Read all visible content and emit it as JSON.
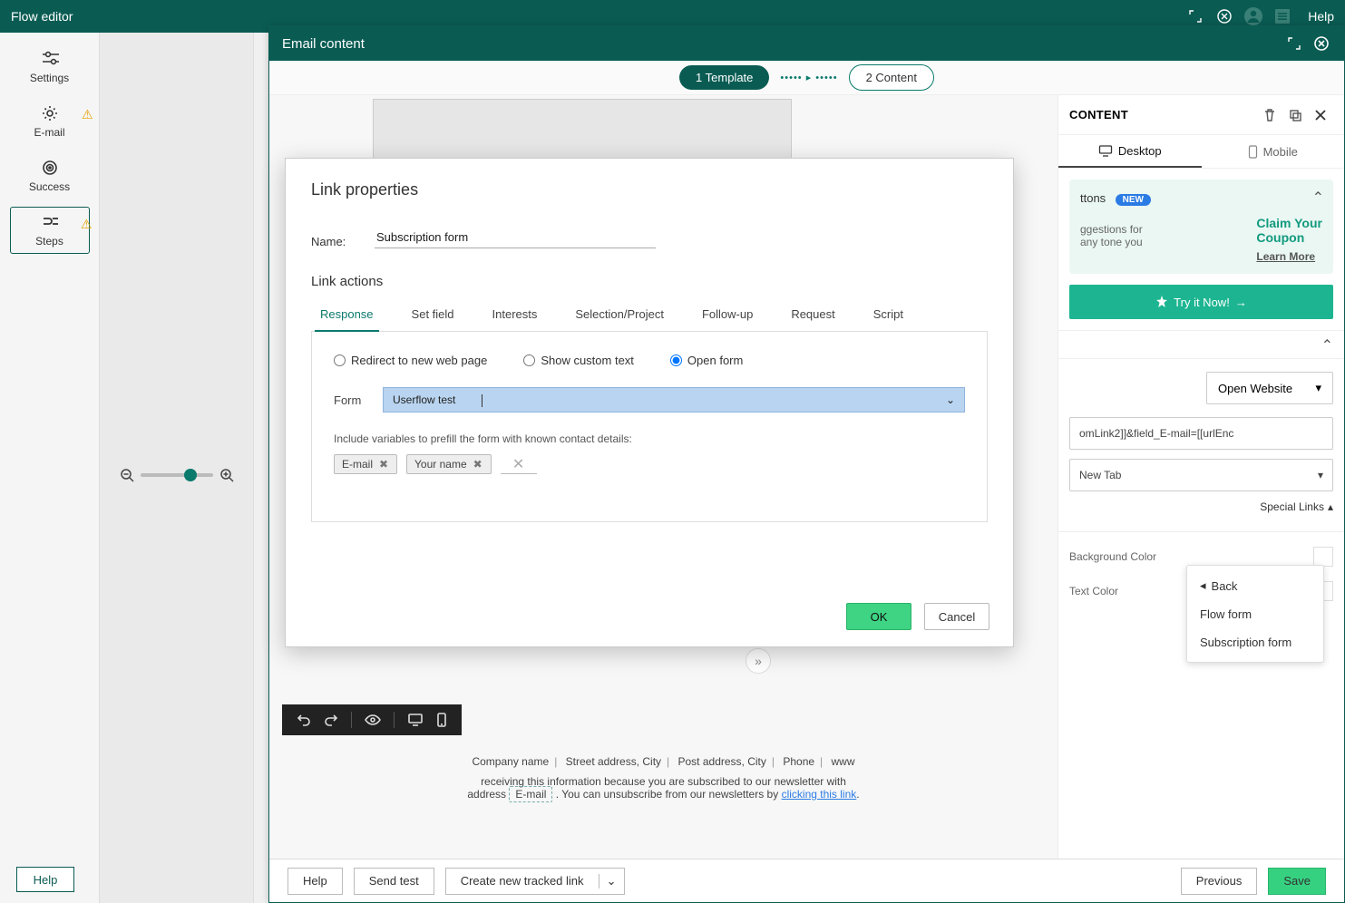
{
  "topbar": {
    "title": "Flow editor",
    "help": "Help"
  },
  "leftnav": {
    "items": [
      {
        "label": "Settings"
      },
      {
        "label": "E-mail",
        "warn": true
      },
      {
        "label": "Success"
      },
      {
        "label": "Steps",
        "warn": true,
        "selected": true
      }
    ],
    "help": "Help"
  },
  "modal": {
    "title": "Email content",
    "steps": {
      "one": "1 Template",
      "two": "2 Content"
    }
  },
  "sidepanel": {
    "title": "CONTENT",
    "device": {
      "desktop": "Desktop",
      "mobile": "Mobile"
    },
    "promo": {
      "ttons": "ttons",
      "new": "NEW",
      "subline1": "ggestions for",
      "subline2": "any tone you",
      "claim1": "Claim Your",
      "claim2": "Coupon",
      "learn": "Learn More"
    },
    "tryit": "Try it Now!",
    "action": "Open Website",
    "url": "omLink2]]&field_E-mail=[[urlEnc",
    "newtab": "New Tab",
    "special": "Special Links",
    "sl_menu": {
      "back": "Back",
      "flow": "Flow form",
      "sub": "Subscription form"
    },
    "bgcolor": "Background Color",
    "txtcolor": "Text Color"
  },
  "footer": {
    "help": "Help",
    "sendtest": "Send test",
    "createlink": "Create new tracked link",
    "previous": "Previous",
    "save": "Save"
  },
  "preview_footer": {
    "company": "Company name",
    "street": "Street address, City",
    "post": "Post address, City",
    "phone": "Phone",
    "www": "www",
    "line2_a": "receiving this information because you are subscribed to our newsletter with",
    "line2_b": "address",
    "email": "E-mail",
    "line2_c": ". You can unsubscribe from our newsletters by ",
    "link": "clicking this link"
  },
  "dialog": {
    "title": "Link properties",
    "name_label": "Name:",
    "name_value": "Subscription form",
    "section": "Link actions",
    "tabs": [
      "Response",
      "Set field",
      "Interests",
      "Selection/Project",
      "Follow-up",
      "Request",
      "Script"
    ],
    "radios": {
      "redirect": "Redirect to new web page",
      "custom": "Show custom text",
      "open": "Open form"
    },
    "form_label": "Form",
    "form_value": "Userflow test",
    "help": "Include variables to prefill the form with known contact details:",
    "chips": [
      "E-mail",
      "Your name"
    ],
    "ok": "OK",
    "cancel": "Cancel"
  }
}
